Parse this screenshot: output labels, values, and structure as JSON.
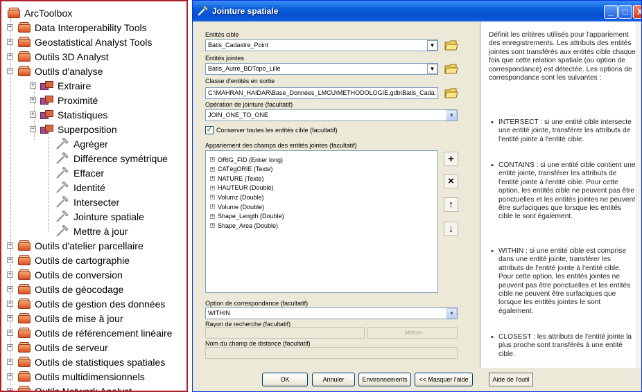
{
  "toolbox": {
    "root": "ArcToolbox",
    "items": [
      {
        "label": "Data Interoperability Tools"
      },
      {
        "label": "Geostatistical Analyst Tools"
      },
      {
        "label": "Outils 3D Analyst"
      },
      {
        "label": "Outils d'analyse"
      },
      {
        "label": "Extraire"
      },
      {
        "label": "Proximité"
      },
      {
        "label": "Statistiques"
      },
      {
        "label": "Superposition"
      },
      {
        "label": "Agréger"
      },
      {
        "label": "Différence symétrique"
      },
      {
        "label": "Effacer"
      },
      {
        "label": "Identité"
      },
      {
        "label": "Intersecter"
      },
      {
        "label": "Jointure spatiale"
      },
      {
        "label": "Mettre à jour"
      },
      {
        "label": "Outils d'atelier parcellaire"
      },
      {
        "label": "Outils de cartographie"
      },
      {
        "label": "Outils de conversion"
      },
      {
        "label": "Outils de géocodage"
      },
      {
        "label": "Outils de gestion des données"
      },
      {
        "label": "Outils de mise à jour"
      },
      {
        "label": "Outils de référencement linéaire"
      },
      {
        "label": "Outils de serveur"
      },
      {
        "label": "Outils de statistiques spatiales"
      },
      {
        "label": "Outils multidimensionnels"
      },
      {
        "label": "Outils Network Analyst"
      }
    ]
  },
  "dialog": {
    "title": "Jointure spatiale",
    "window_buttons": {
      "minimize": "_",
      "maximize": "□",
      "close": "X"
    },
    "form": {
      "target_label": "Entités cible",
      "target_value": "Batis_Cadastre_Point",
      "join_label": "Entités jointes",
      "join_value": "Batis_Autre_BDTopo_Lille",
      "output_label": "Classe d'entités en sortie",
      "output_value": "C:\\MAHRAN_HAIDAR\\Base_Données_LMCU\\METHODOLOGIE.gdb\\Batis_Cada:",
      "operation_label": "Opération de jointure (facultatif)",
      "operation_value": "JOIN_ONE_TO_ONE",
      "keep_all_label": "Conserver toutes les entités cible (facultatif)",
      "field_map_label": "Appariement des champs des entités jointes (facultatif)",
      "fields": [
        "ORIG_FID (Entier long)",
        "CATégORIE (Texte)",
        "NATURE (Texte)",
        "HAUTEUR (Double)",
        "Volumz (Double)",
        "Volume (Double)",
        "Shape_Length (Double)",
        "Shape_Area (Double)"
      ],
      "side_buttons": {
        "add": "+",
        "remove": "×",
        "up": "↑",
        "down": "↓"
      },
      "match_option_label": "Option de correspondance (facultatif)",
      "match_option_value": "WITHIN",
      "search_radius_label": "Rayon de recherche (facultatif)",
      "search_radius_unit": "Mètres",
      "distance_field_label": "Nom du champ de distance (facultatif)"
    },
    "help": {
      "intro": "Définit les critères utilisés pour l'appariement des enregistrements. Les attributs des entités jointes sont transférés aux entités cible chaque fois que cette relation spatiale (ou option de correspondance) est détectée. Les options de correspondance sont les suivantes :",
      "bullets": [
        "INTERSECT : si une entité cible intersecte une entité jointe, transférer les attributs de l'entité jointe à l'entité cible.",
        "CONTAINS : si une entité cible contient une entité jointe, transférer les attributs de l'entité jointe à l'entité cible. Pour cette option, les entités cible ne peuvent pas être ponctuelles et les entités jointes ne peuvent être surfaciques que lorsque les entités cible le sont également.",
        "WITHIN : si une entité cible est comprise dans une entité jointe, transférer les attributs de l'entité jointe à l'entité cible. Pour cette option, les entités jointes ne peuvent pas être ponctuelles et les entités cible ne peuvent être surfaciques que lorsque les entités jointes le sont également.",
        "CLOSEST : les attributs de l'entité jointe la plus proche sont transférés à une entité cible."
      ]
    },
    "buttons": {
      "ok": "OK",
      "cancel": "Annuler",
      "environments": "Environnements",
      "hide_help": "<< Masquer l'aide",
      "tool_help": "Aide de l'outil"
    }
  }
}
